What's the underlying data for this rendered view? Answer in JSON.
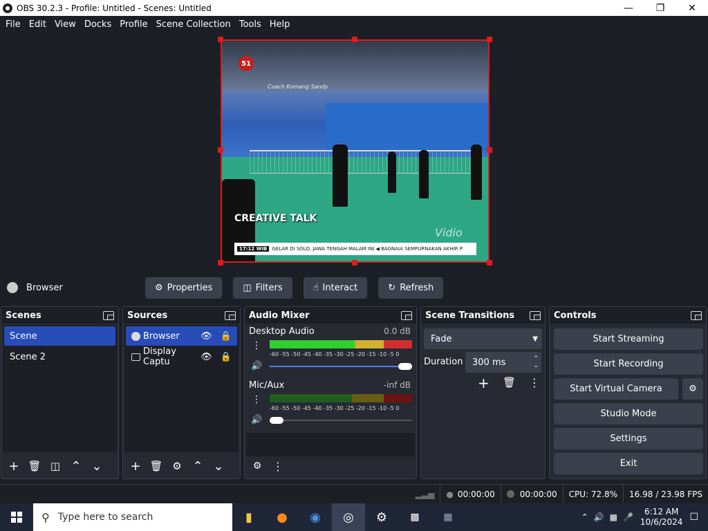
{
  "window": {
    "title": "OBS 30.2.3 - Profile: Untitled - Scenes: Untitled"
  },
  "menu": [
    "File",
    "Edit",
    "View",
    "Docks",
    "Profile",
    "Scene Collection",
    "Tools",
    "Help"
  ],
  "preview": {
    "logo_number": "51",
    "coach_text": "Coach Komang Sandy",
    "creative_text": "CREATIVE TALK",
    "ticker_time": "17:12 WIB",
    "ticker_text": "GELAR DI SOLO, JAWA TENGAH MALAM INI  ◀  BAGNAIA SEMPURNAKAN AKHIR P",
    "watermark": "Vidio"
  },
  "source_toolbar": {
    "source_name": "Browser",
    "properties": "Properties",
    "filters": "Filters",
    "interact": "Interact",
    "refresh": "Refresh"
  },
  "scenes": {
    "title": "Scenes",
    "items": [
      "Scene",
      "Scene 2"
    ],
    "selected": 0
  },
  "sources": {
    "title": "Sources",
    "items": [
      "Browser",
      "Display Captu"
    ],
    "selected": 0
  },
  "audio_mixer": {
    "title": "Audio Mixer",
    "scale": "-60 -55 -50 -45 -40 -35 -30 -25 -20 -15 -10 -5  0",
    "channels": [
      {
        "name": "Desktop Audio",
        "db": "0.0 dB",
        "level": 1.0,
        "volume": 1.0
      },
      {
        "name": "Mic/Aux",
        "db": "-inf dB",
        "level": 0.0,
        "volume": 0.0
      }
    ]
  },
  "scene_transitions": {
    "title": "Scene Transitions",
    "transition": "Fade",
    "duration_label": "Duration",
    "duration": "300 ms"
  },
  "controls": {
    "title": "Controls",
    "start_streaming": "Start Streaming",
    "start_recording": "Start Recording",
    "start_virtual_camera": "Start Virtual Camera",
    "studio_mode": "Studio Mode",
    "settings": "Settings",
    "exit": "Exit"
  },
  "status": {
    "stream_time": "00:00:00",
    "record_time": "00:00:00",
    "cpu": "CPU: 72.8%",
    "fps": "16.98 / 23.98 FPS"
  },
  "taskbar": {
    "search_placeholder": "Type here to search",
    "time": "6:12 AM",
    "date": "10/6/2024"
  }
}
